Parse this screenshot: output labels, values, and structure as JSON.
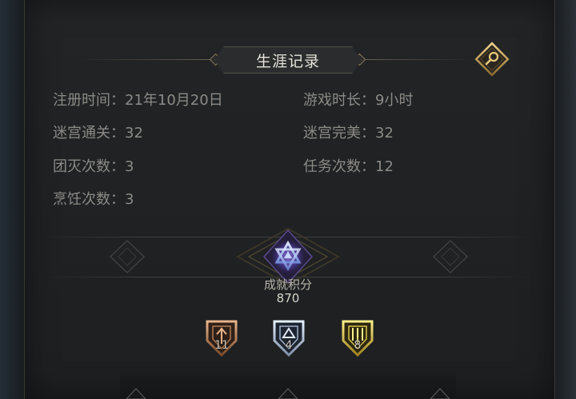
{
  "career": {
    "title": "生涯记录",
    "stats": [
      {
        "label": "注册时间：",
        "value": "21年10月20日"
      },
      {
        "label": "游戏时长：",
        "value": "9小时"
      },
      {
        "label": "迷宫通关：",
        "value": "32"
      },
      {
        "label": "迷宫完美：",
        "value": "32"
      },
      {
        "label": "团灭次数：",
        "value": "3"
      },
      {
        "label": "任务次数：",
        "value": "12"
      },
      {
        "label": "烹饪次数：",
        "value": "3"
      }
    ]
  },
  "achievement": {
    "label": "成就积分",
    "points": "870",
    "badges": [
      {
        "tier": "bronze",
        "count": "11",
        "icon": "bronze-shield-icon"
      },
      {
        "tier": "silver",
        "count": "4",
        "icon": "silver-shield-icon"
      },
      {
        "tier": "gold",
        "count": "8",
        "icon": "gold-shield-icon"
      }
    ]
  },
  "icons": {
    "search": "magnifier-icon",
    "emblem": "star-triangle-emblem-icon"
  },
  "colors": {
    "accent_gold": "#c9a55a",
    "text_dim": "#8c8a86",
    "emblem_purple": "#6a4fc0"
  }
}
